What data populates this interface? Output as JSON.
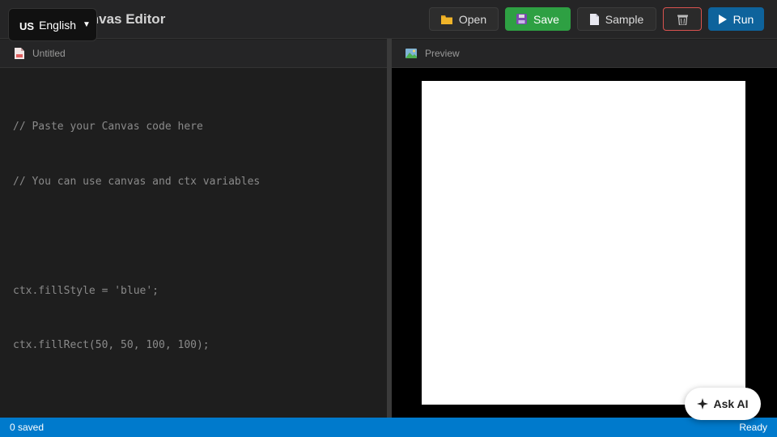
{
  "header": {
    "title": "Canvas Editor",
    "language": {
      "flag": "US",
      "label": "English",
      "caret": "▼"
    },
    "buttons": {
      "open": "Open",
      "save": "Save",
      "sample": "Sample",
      "run": "Run"
    },
    "icons": {
      "open": "folder-icon",
      "save": "floppy-disk-icon",
      "sample": "document-icon",
      "clear": "trash-icon",
      "run": "play-icon"
    }
  },
  "editor": {
    "tab_label": "Untitled",
    "icon": "file-icon",
    "code_lines": [
      "// Paste your Canvas code here",
      "// You can use canvas and ctx variables",
      "",
      "ctx.fillStyle = 'blue';",
      "ctx.fillRect(50, 50, 100, 100);"
    ]
  },
  "preview": {
    "tab_label": "Preview",
    "icon": "image-icon"
  },
  "status": {
    "left": "0 saved",
    "right": "Ready"
  },
  "ask_ai": {
    "label": "Ask AI",
    "icon": "sparkle-icon"
  },
  "colors": {
    "save": "#2ea043",
    "run": "#0e639c",
    "clear_border": "#d9534f",
    "statusbar": "#007acc"
  }
}
